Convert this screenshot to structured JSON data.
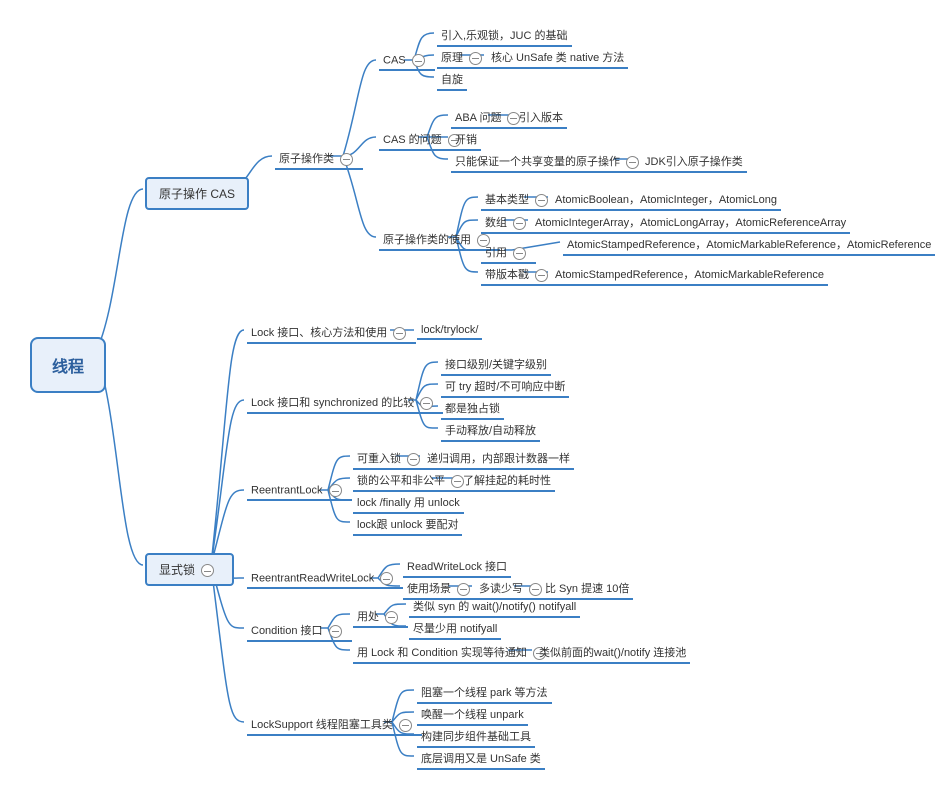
{
  "root": "线程",
  "m1": "原子操作 CAS",
  "m2": "显式锁",
  "n1": "原子操作类",
  "n2": "CAS",
  "n3": "CAS 的问题",
  "n4": "原子操作类的使用",
  "n5": "引入,乐观锁，JUC 的基础",
  "n6": "原理",
  "n7": "自旋",
  "n8": "核心 UnSafe 类 native 方法",
  "n9": "ABA 问题",
  "n10": "开销",
  "n11": "只能保证一个共享变量的原子操作",
  "n12": "引入版本",
  "n13": "JDK引入原子操作类",
  "n14": "基本类型",
  "n15": "数组",
  "n16": "引用",
  "n17": "带版本戳",
  "n18": "AtomicBoolean，AtomicInteger，AtomicLong",
  "n19": "AtomicIntegerArray，AtomicLongArray，AtomicReferenceArray",
  "n20": "AtomicStampedReference，AtomicMarkableReference，AtomicReference",
  "n21": "AtomicStampedReference，AtomicMarkableReference",
  "l1": "Lock 接口、核心方法和使用",
  "l2": "lock/trylock/",
  "l3": "Lock 接口和 synchronized 的比较",
  "l4": "接口级别/关键字级别",
  "l5": "可 try 超时/不可响应中断",
  "l6": "都是独占锁",
  "l7": "手动释放/自动释放",
  "l8": "ReentrantLock",
  "l9": "可重入锁",
  "l10": "递归调用，内部跟计数器一样",
  "l11": "锁的公平和非公平",
  "l12": "了解挂起的耗时性",
  "l13": "lock /finally 用 unlock",
  "l14": "lock跟 unlock 要配对",
  "l15": "ReentrantReadWriteLock",
  "l16": "ReadWriteLock 接口",
  "l17": "使用场景",
  "l18": "多读少写",
  "l19": "比 Syn 提速 10倍",
  "l20": "Condition 接口",
  "l21": "用处",
  "l22": "类似 syn 的 wait()/notify() notifyall",
  "l23": "尽量少用 notifyall",
  "l24": "用 Lock 和 Condition 实现等待通知",
  "l25": "类似前面的wait()/notify 连接池",
  "l26": "LockSupport 线程阻塞工具类",
  "l27": "阻塞一个线程 park 等方法",
  "l28": "唤醒一个线程 unpark",
  "l29": "构建同步组件基础工具",
  "l30": "底层调用又是 UnSafe 类"
}
